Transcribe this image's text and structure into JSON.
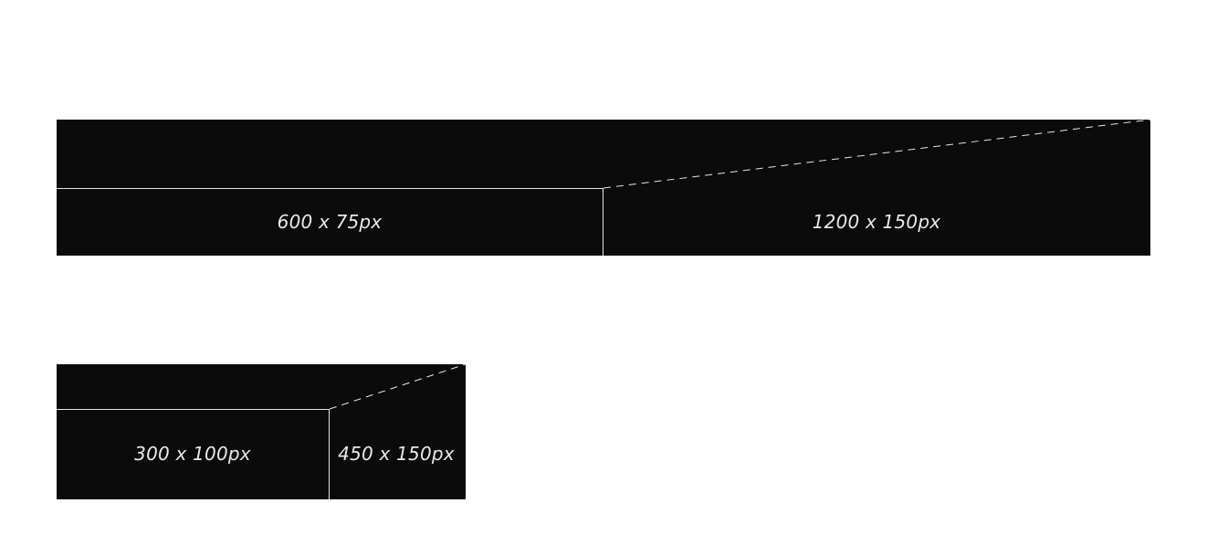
{
  "background_color": "#ffffff",
  "box_color": "#0b0b0b",
  "line_color": "#e6e6e6",
  "diagrams": [
    {
      "inner_label": "600 x 75px",
      "outer_label": "1200 x 150px"
    },
    {
      "inner_label": "300 x 100px",
      "outer_label": "450 x 150px"
    }
  ]
}
